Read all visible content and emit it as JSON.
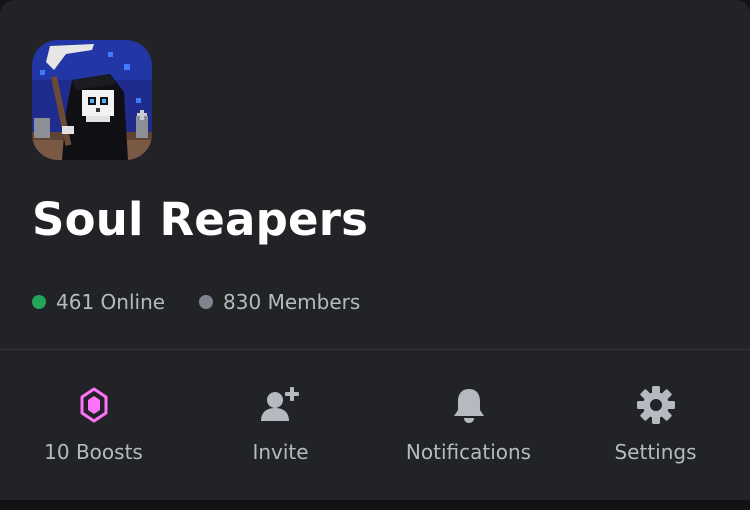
{
  "server": {
    "name": "Soul Reapers",
    "icon": "grim-reaper-pixel-art"
  },
  "stats": {
    "online_label": "461 Online",
    "members_label": "830 Members",
    "online_color": "#23a55a",
    "members_color": "#80848e"
  },
  "actions": [
    {
      "label": "10 Boosts",
      "icon": "boost-gem-icon",
      "color": "#ff73fa"
    },
    {
      "label": "Invite",
      "icon": "add-user-icon",
      "color": "#b5bac1"
    },
    {
      "label": "Notifications",
      "icon": "bell-icon",
      "color": "#b5bac1"
    },
    {
      "label": "Settings",
      "icon": "gear-icon",
      "color": "#b5bac1"
    }
  ],
  "colors": {
    "background": "#222327",
    "text_primary": "#ffffff",
    "text_secondary": "#b5bac1"
  }
}
